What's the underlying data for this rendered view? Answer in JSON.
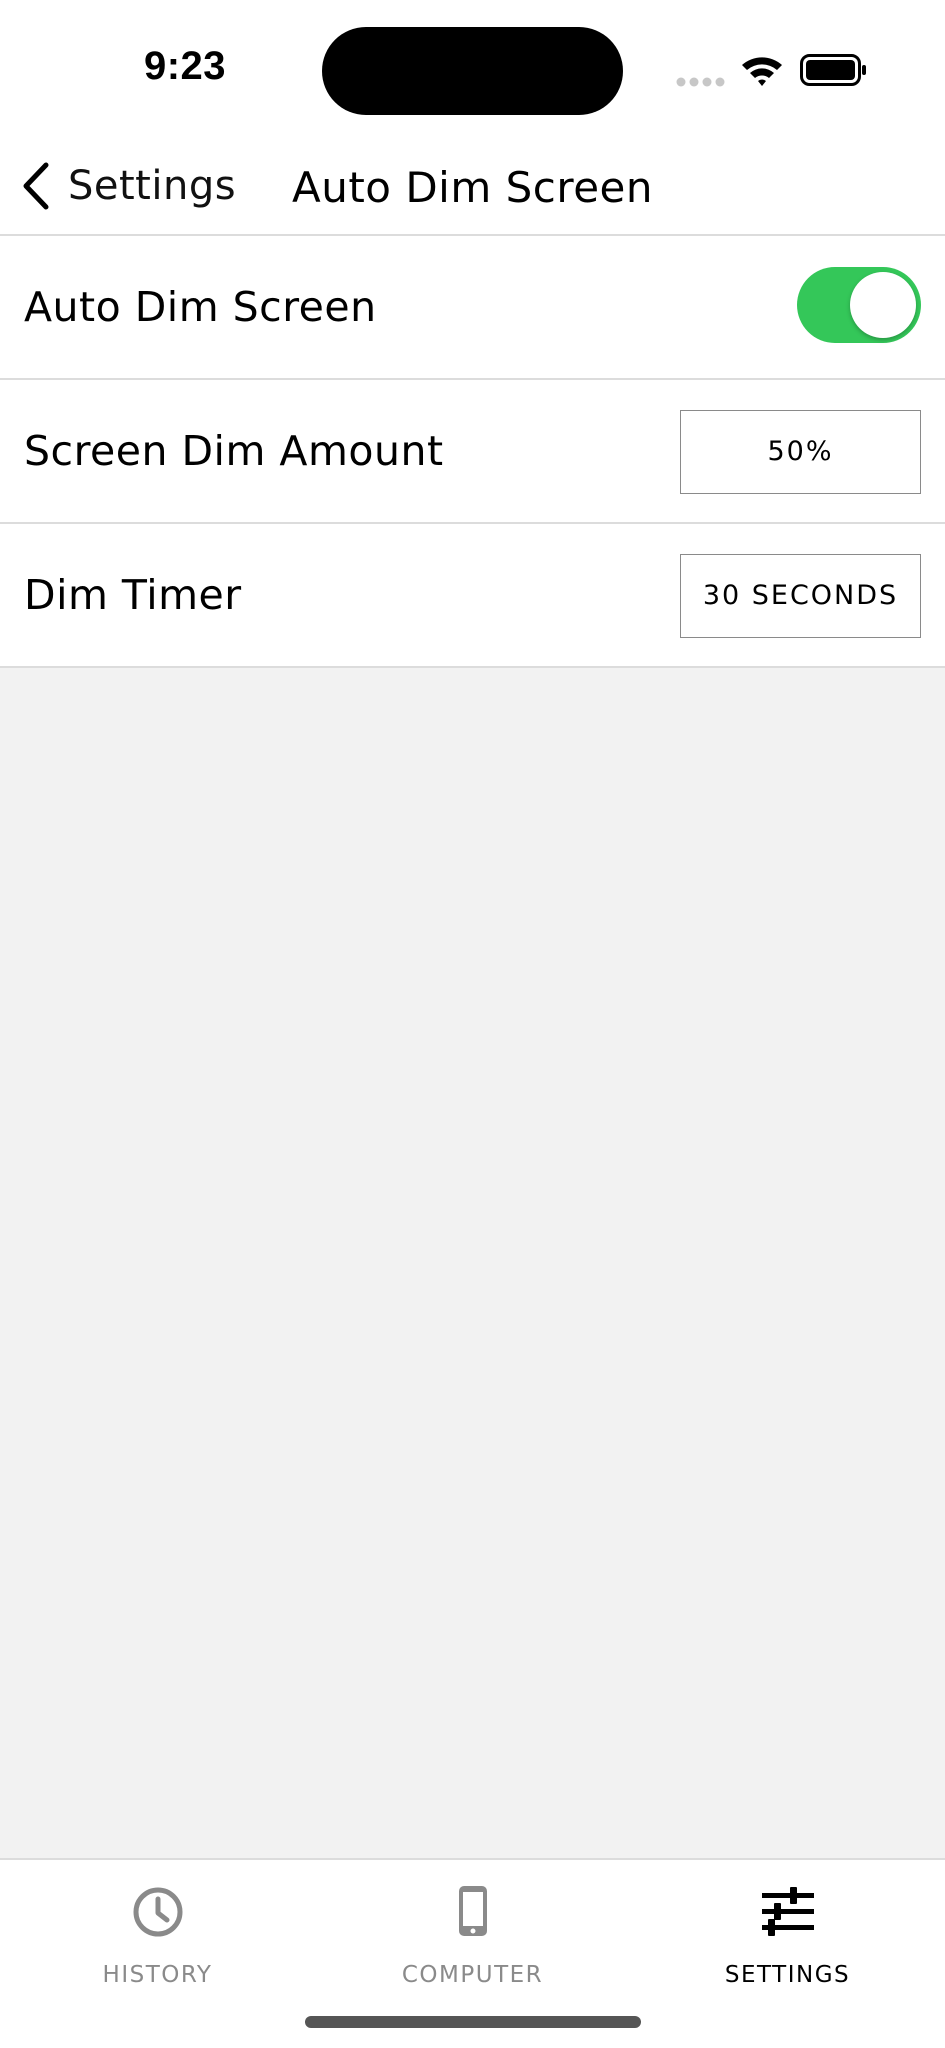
{
  "status_bar": {
    "time": "9:23"
  },
  "nav": {
    "back_label": "Settings",
    "title": "Auto Dim Screen"
  },
  "settings": [
    {
      "label": "Auto Dim Screen",
      "control": "toggle",
      "enabled": true
    },
    {
      "label": "Screen Dim Amount",
      "control": "value",
      "value": "50%"
    },
    {
      "label": "Dim Timer",
      "control": "value",
      "value": "30 SECONDS"
    }
  ],
  "tabs": [
    {
      "label": "HISTORY",
      "icon": "clock-icon",
      "active": false
    },
    {
      "label": "COMPUTER",
      "icon": "phone-icon",
      "active": false
    },
    {
      "label": "SETTINGS",
      "icon": "sliders-icon",
      "active": true
    }
  ],
  "colors": {
    "toggle_on": "#34c759",
    "tab_inactive": "#8a8a8a",
    "tab_active": "#000000",
    "background": "#f2f2f2"
  }
}
